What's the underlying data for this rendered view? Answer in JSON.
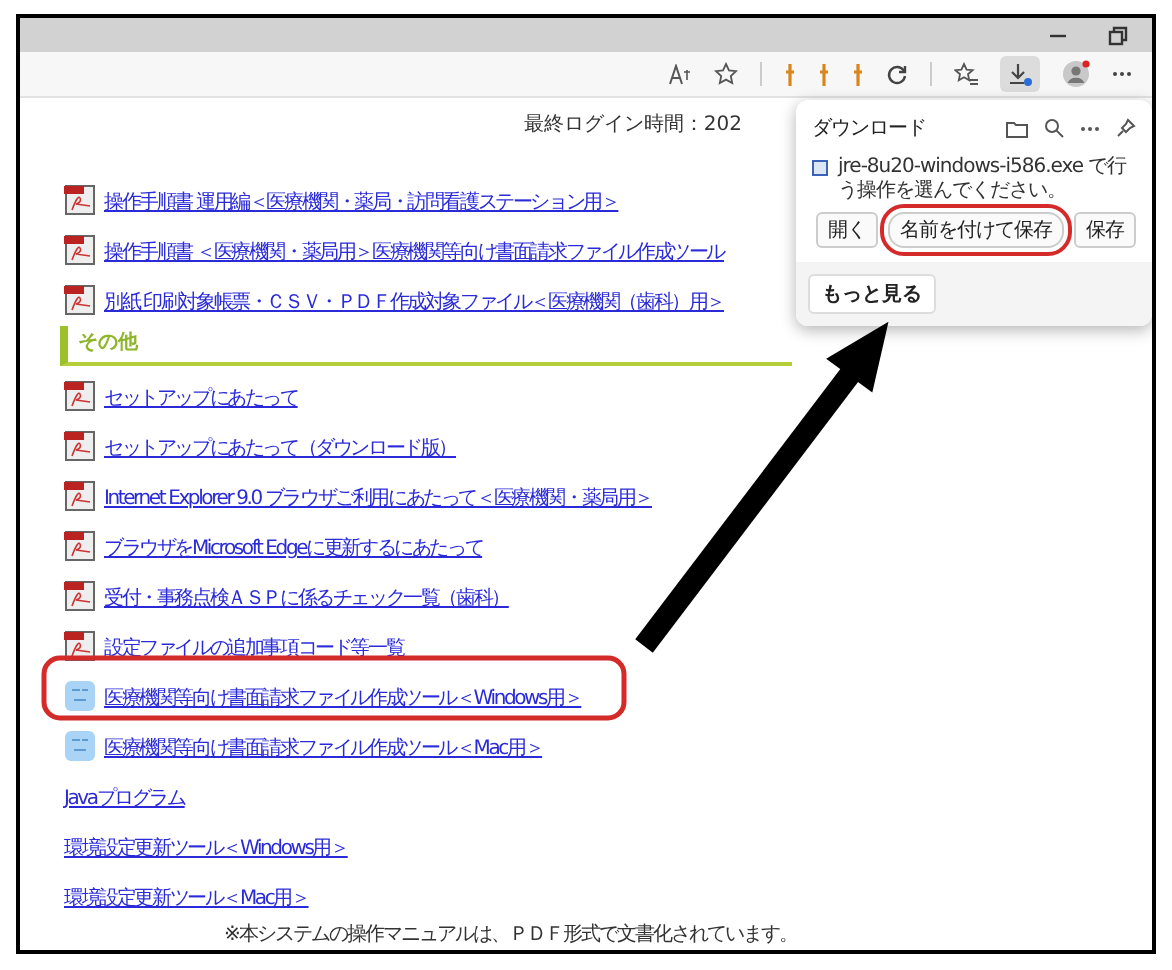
{
  "toolbar": {
    "downloads_active": true
  },
  "header": {
    "last_login": "最終ログイン時間：202"
  },
  "links_top": [
    {
      "kind": "pdf",
      "label": "操作手順書 運用編＜医療機関・薬局・訪問看護ステーション用＞"
    },
    {
      "kind": "pdf",
      "label": "操作手順書 ＜医療機関・薬局用＞医療機関等向け書面請求ファイル作成ツール"
    },
    {
      "kind": "pdf",
      "label": "別紙 印刷対象帳票・ＣＳＶ・ＰＤＦ作成対象ファイル＜医療機関（歯科）用＞"
    }
  ],
  "section": {
    "title": "その他"
  },
  "links": [
    {
      "kind": "pdf",
      "label": "セットアップにあたって"
    },
    {
      "kind": "pdf",
      "label": "セットアップにあたって（ダウンロード版）"
    },
    {
      "kind": "pdf",
      "label": "Internet Explorer 9.0 ブラウザご利用にあたって＜医療機関・薬局用＞"
    },
    {
      "kind": "pdf",
      "label": "ブラウザをMicrosoft Edgeに更新するにあたって"
    },
    {
      "kind": "pdf",
      "label": "受付・事務点検ＡＳＰに係るチェック一覧（歯科）"
    },
    {
      "kind": "pdf",
      "label": "設定ファイルの追加事項コード等一覧"
    },
    {
      "kind": "tool",
      "label": "医療機関等向け書面請求ファイル作成ツール＜Windows用＞"
    },
    {
      "kind": "tool",
      "label": "医療機関等向け書面請求ファイル作成ツール＜Mac用＞"
    },
    {
      "kind": "java",
      "label": "Javaプログラム"
    },
    {
      "kind": "refresh",
      "label": "環境設定更新ツール＜Windows用＞"
    },
    {
      "kind": "refresh",
      "label": "環境設定更新ツール＜Mac用＞"
    }
  ],
  "footer_note": "※本システムの操作マニュアルは、ＰＤＦ形式で文書化されています。",
  "download_panel": {
    "title": "ダウンロード",
    "message": "jre-8u20-windows-i586.exe で行う操作を選んでください。",
    "buttons": [
      {
        "label": "開く",
        "annotated": false
      },
      {
        "label": "名前を付けて保存",
        "annotated": true
      },
      {
        "label": "保存",
        "annotated": false
      }
    ],
    "more_button": "もっと見る"
  }
}
